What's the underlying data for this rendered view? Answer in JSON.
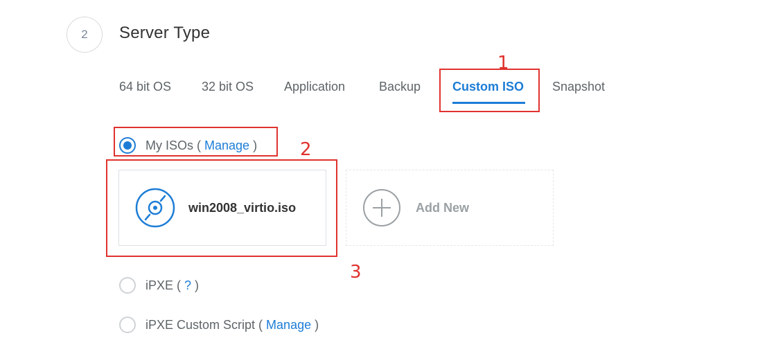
{
  "section": {
    "step_number": "2",
    "title": "Server Type"
  },
  "tabs": [
    {
      "label": "64 bit OS",
      "active": false
    },
    {
      "label": "32 bit OS",
      "active": false
    },
    {
      "label": "Application",
      "active": false
    },
    {
      "label": "Backup",
      "active": false
    },
    {
      "label": "Custom ISO",
      "active": true
    },
    {
      "label": "Snapshot",
      "active": false
    }
  ],
  "options": {
    "my_isos": {
      "label": "My ISOs",
      "open_paren": "(",
      "link": "Manage",
      "close_paren": ")",
      "checked": true
    },
    "ipxe": {
      "label": "iPXE",
      "open_paren": "(",
      "link": "?",
      "close_paren": ")",
      "checked": false
    },
    "ipxe_script": {
      "label": "iPXE Custom Script",
      "open_paren": "(",
      "link": "Manage",
      "close_paren": ")",
      "checked": false
    }
  },
  "iso_cards": [
    {
      "name": "win2008_virtio.iso",
      "icon": "disc-icon"
    }
  ],
  "add_new": {
    "label": "Add New",
    "icon": "plus-circle-icon"
  },
  "annotations": [
    "1",
    "2",
    "3"
  ],
  "colors": {
    "accent": "#1d7dd6",
    "annotation": "#e0322e",
    "muted": "#9aa0a4"
  }
}
